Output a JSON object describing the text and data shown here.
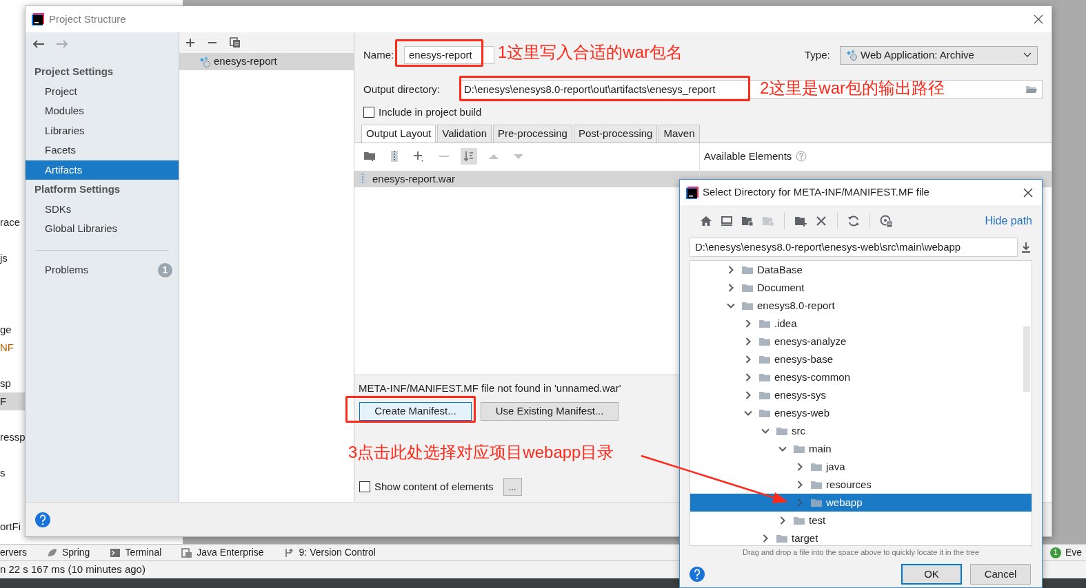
{
  "background_ide": {
    "tree_fragments": [
      {
        "text": "race",
        "kind": "plain",
        "selected": false
      },
      {
        "text": "js",
        "kind": "plain",
        "selected": false
      },
      {
        "text": "ge",
        "kind": "plain",
        "selected": false
      },
      {
        "text": "NF",
        "kind": "modified",
        "selected": false
      },
      {
        "text": "sp",
        "kind": "plain",
        "selected": false
      },
      {
        "text": "F",
        "kind": "plain",
        "selected": true
      },
      {
        "text": "ressp",
        "kind": "plain",
        "selected": false
      },
      {
        "text": "s",
        "kind": "plain",
        "selected": false
      },
      {
        "text": "ortFi",
        "kind": "plain",
        "selected": false
      }
    ],
    "tool_windows": [
      {
        "label": "ervers",
        "kind": "plain"
      },
      {
        "label": "Spring",
        "kind": "spring"
      },
      {
        "label": "Terminal",
        "kind": "terminal"
      },
      {
        "label": "Java Enterprise",
        "kind": "javaee"
      },
      {
        "label": "9: Version Control",
        "kind": "vcs"
      }
    ],
    "event_log": {
      "count": "1",
      "label": "Eve"
    },
    "status_text": "n 22 s 167 ms (10 minutes ago)"
  },
  "project_structure": {
    "title": "Project Structure",
    "sidebar": {
      "sections": [
        {
          "heading": "Project Settings",
          "items": [
            {
              "label": "Project",
              "selected": false
            },
            {
              "label": "Modules",
              "selected": false
            },
            {
              "label": "Libraries",
              "selected": false
            },
            {
              "label": "Facets",
              "selected": false
            },
            {
              "label": "Artifacts",
              "selected": true
            }
          ]
        },
        {
          "heading": "Platform Settings",
          "items": [
            {
              "label": "SDKs",
              "selected": false
            },
            {
              "label": "Global Libraries",
              "selected": false
            }
          ]
        }
      ],
      "problems": {
        "label": "Problems",
        "count": "1"
      }
    },
    "artifacts": [
      {
        "name": "enesys-report",
        "selected": true
      }
    ],
    "name_label": "Name:",
    "name_value": "enesys-report",
    "type_label": "Type:",
    "type_value": "Web Application: Archive",
    "output_label": "Output directory:",
    "output_value": "D:\\enesys\\enesys8.0-report\\out\\artifacts\\enesys_report",
    "include_in_build": {
      "label": "Include in project build",
      "checked": false
    },
    "tabs": [
      {
        "label": "Output Layout",
        "selected": true
      },
      {
        "label": "Validation",
        "selected": false
      },
      {
        "label": "Pre-processing",
        "selected": false
      },
      {
        "label": "Post-processing",
        "selected": false
      },
      {
        "label": "Maven",
        "selected": false
      }
    ],
    "layout_toolbar": [
      {
        "kind": "new-dir",
        "disabled": false,
        "on": false
      },
      {
        "kind": "archive",
        "disabled": false,
        "on": false
      },
      {
        "kind": "add",
        "disabled": false,
        "on": false
      },
      {
        "kind": "remove",
        "disabled": true,
        "on": false
      },
      {
        "kind": "sort",
        "disabled": false,
        "on": true
      },
      {
        "kind": "up",
        "disabled": true,
        "on": false
      },
      {
        "kind": "down",
        "disabled": true,
        "on": false
      }
    ],
    "layout_items": [
      {
        "name": "enesys-report.war",
        "selected": true
      }
    ],
    "available_elements": "Available Elements",
    "manifest_message": "META-INF/MANIFEST.MF file not found in 'unnamed.war'",
    "manifest_buttons": [
      {
        "label": "Create Manifest...",
        "focused": true
      },
      {
        "label": "Use Existing Manifest...",
        "focused": false
      }
    ],
    "show_content": {
      "label": "Show content of elements",
      "checked": false
    },
    "more_button": "..."
  },
  "select_directory": {
    "title": "Select Directory for META-INF/MANIFEST.MF file",
    "toolbar": [
      {
        "kind": "home",
        "disabled": false
      },
      {
        "kind": "desktop",
        "disabled": false
      },
      {
        "kind": "project",
        "disabled": false
      },
      {
        "kind": "module",
        "disabled": true
      },
      {
        "kind": "new-folder",
        "disabled": false
      },
      {
        "kind": "delete",
        "disabled": false
      },
      {
        "kind": "refresh",
        "disabled": false
      },
      {
        "kind": "hidden-files",
        "disabled": false
      }
    ],
    "hide_path": "Hide path",
    "path": "D:\\enesys\\enesys8.0-report\\enesys-web\\src\\main\\webapp",
    "tree": [
      {
        "label": "DataBase",
        "expanded": false,
        "selected": false
      },
      {
        "label": "Document",
        "expanded": false,
        "selected": false
      },
      {
        "label": "enesys8.0-report",
        "expanded": true,
        "selected": false,
        "children": [
          {
            "label": ".idea",
            "expanded": false,
            "selected": false
          },
          {
            "label": "enesys-analyze",
            "expanded": false,
            "selected": false
          },
          {
            "label": "enesys-base",
            "expanded": false,
            "selected": false
          },
          {
            "label": "enesys-common",
            "expanded": false,
            "selected": false
          },
          {
            "label": "enesys-sys",
            "expanded": false,
            "selected": false
          },
          {
            "label": "enesys-web",
            "expanded": true,
            "selected": false,
            "children": [
              {
                "label": "src",
                "expanded": true,
                "selected": false,
                "children": [
                  {
                    "label": "main",
                    "expanded": true,
                    "selected": false,
                    "children": [
                      {
                        "label": "java",
                        "expanded": false,
                        "selected": false
                      },
                      {
                        "label": "resources",
                        "expanded": false,
                        "selected": false
                      },
                      {
                        "label": "webapp",
                        "expanded": false,
                        "selected": true
                      }
                    ]
                  },
                  {
                    "label": "test",
                    "expanded": false,
                    "selected": false
                  }
                ]
              },
              {
                "label": "target",
                "expanded": false,
                "selected": false
              }
            ]
          }
        ]
      }
    ],
    "hint": "Drag and drop a file into the space above to quickly locate it in the tree",
    "buttons": [
      {
        "label": "OK",
        "focused": true
      },
      {
        "label": "Cancel",
        "focused": false
      }
    ]
  },
  "annotations": [
    {
      "text": "1这里写入合适的war包名"
    },
    {
      "text": "2这里是war包的输出路径"
    },
    {
      "text": "3点击此处选择对应项目webapp目录"
    }
  ]
}
